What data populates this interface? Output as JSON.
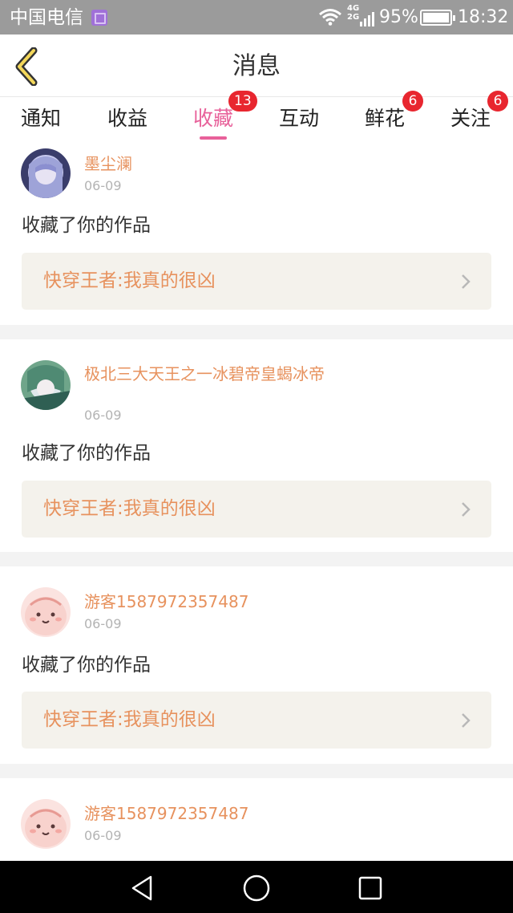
{
  "status_bar": {
    "carrier": "中国电信",
    "network": "4G\n2G",
    "network_top": "4G",
    "network_bottom": "2G",
    "battery": "95%",
    "time": "18:32"
  },
  "header": {
    "title": "消息"
  },
  "tabs": [
    {
      "label": "通知",
      "badge": ""
    },
    {
      "label": "收益",
      "badge": ""
    },
    {
      "label": "收藏",
      "badge": "13",
      "active": true
    },
    {
      "label": "互动",
      "badge": ""
    },
    {
      "label": "鲜花",
      "badge": "6"
    },
    {
      "label": "关注",
      "badge": "6"
    }
  ],
  "colors": {
    "accent_pink": "#e8619a",
    "name_orange": "#e7925e",
    "badge_red": "#e8262f",
    "link_bg": "#f4f2ec"
  },
  "messages": [
    {
      "username": "墨尘澜",
      "date": "06-09",
      "action": "收藏了你的作品",
      "work": "快穿王者:我真的很凶",
      "avatar": "anime-avatar-icon"
    },
    {
      "username": "极北三大天王之一冰碧帝皇蝎冰帝",
      "date": "06-09",
      "action": "收藏了你的作品",
      "work": "快穿王者:我真的很凶",
      "avatar": "anime-avatar-icon"
    },
    {
      "username": "游客1587972357487",
      "date": "06-09",
      "action": "收藏了你的作品",
      "work": "快穿王者:我真的很凶",
      "avatar": "guest-avatar-icon"
    },
    {
      "username": "游客1587972357487",
      "date": "06-09",
      "action": "",
      "work": "",
      "avatar": "guest-avatar-icon"
    }
  ],
  "nav": {
    "back": "back-triangle-icon",
    "home": "home-circle-icon",
    "recent": "recent-square-icon"
  }
}
